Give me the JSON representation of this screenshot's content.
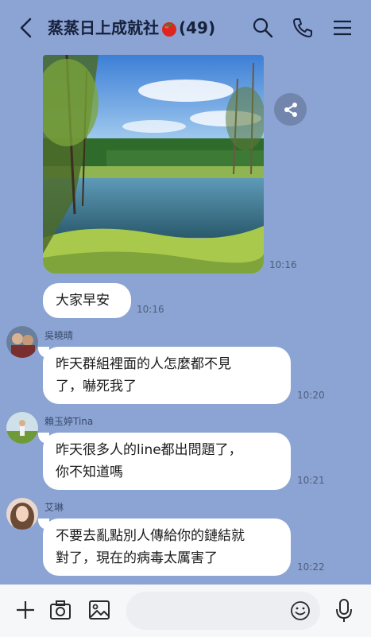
{
  "header": {
    "title": "蒸蒸日上成就社",
    "member_count": "(49)",
    "title_emoji": "tomato"
  },
  "icons": {
    "back": "back-arrow-icon",
    "search": "search-icon",
    "call": "phone-icon",
    "menu": "menu-icon",
    "share": "share-icon",
    "add": "plus-icon",
    "camera": "camera-icon",
    "gallery": "image-icon",
    "emoji": "emoji-icon",
    "mic": "microphone-icon"
  },
  "messages": [
    {
      "type": "image",
      "subject": "lake with trees",
      "time": "10:16"
    },
    {
      "type": "text",
      "text": "大家早安",
      "time": "10:16"
    },
    {
      "type": "text",
      "sender": "吳曉晴",
      "lines": [
        "昨天群組裡面的人怎麼都不見",
        "了，嚇死我了"
      ],
      "time": "10:20"
    },
    {
      "type": "text",
      "sender": "賴玉婷Tina",
      "lines": [
        "昨天很多人的line都出問題了，",
        "你不知道嗎"
      ],
      "time": "10:21"
    },
    {
      "type": "text",
      "sender": "艾琳",
      "lines": [
        "不要去亂點別人傳給你的鏈結就",
        "對了，現在的病毒太厲害了"
      ],
      "time": "10:22"
    }
  ],
  "input": {
    "placeholder": "",
    "value": ""
  },
  "colors": {
    "background": "#8ba4d4",
    "bubble": "#ffffff",
    "title": "#16213b"
  }
}
